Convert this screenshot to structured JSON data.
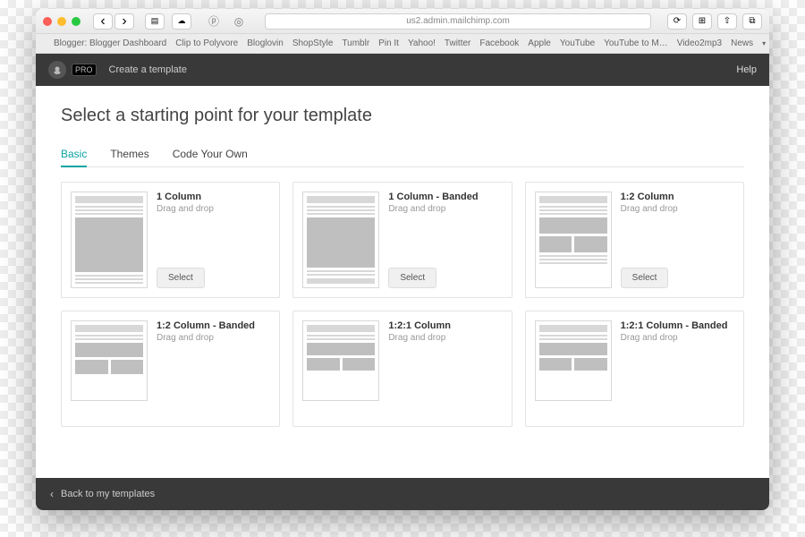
{
  "browser": {
    "url": "us2.admin.mailchimp.com",
    "favorites": [
      "Blogger: Blogger Dashboard",
      "Clip to Polyvore",
      "Bloglovin",
      "ShopStyle",
      "Tumblr",
      "Pin It",
      "Yahoo!",
      "Twitter",
      "Facebook",
      "Apple",
      "YouTube",
      "YouTube to M…",
      "Video2mp3",
      "News"
    ]
  },
  "app": {
    "brand_tag": "PRO",
    "breadcrumb": "Create a template",
    "help": "Help",
    "page_title": "Select a starting point for your template",
    "tabs": [
      "Basic",
      "Themes",
      "Code Your Own"
    ],
    "active_tab": 0,
    "footer_back": "Back to my templates",
    "select_label": "Select"
  },
  "templates": [
    {
      "title": "1 Column",
      "sub": "Drag and drop",
      "layout": "1col"
    },
    {
      "title": "1 Column - Banded",
      "sub": "Drag and drop",
      "layout": "1col-banded"
    },
    {
      "title": "1:2 Column",
      "sub": "Drag and drop",
      "layout": "1-2col"
    },
    {
      "title": "1:2 Column - Banded",
      "sub": "Drag and drop",
      "layout": "1-2col-banded"
    },
    {
      "title": "1:2:1 Column",
      "sub": "Drag and drop",
      "layout": "1-2-1col"
    },
    {
      "title": "1:2:1 Column - Banded",
      "sub": "Drag and drop",
      "layout": "1-2-1col-banded"
    }
  ]
}
